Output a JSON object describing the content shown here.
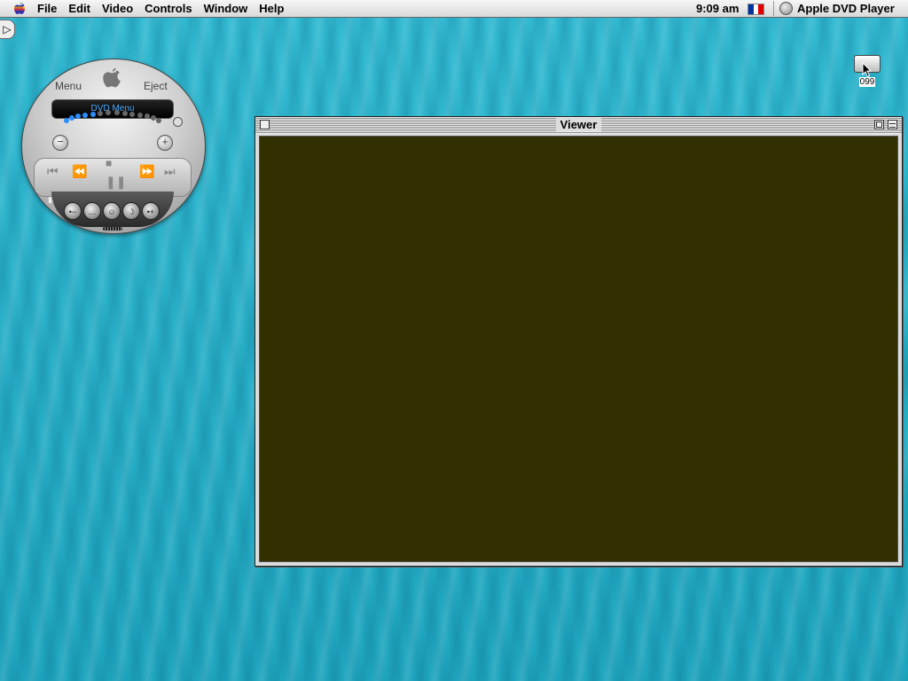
{
  "menubar": {
    "menus": [
      "File",
      "Edit",
      "Video",
      "Controls",
      "Window",
      "Help"
    ],
    "clock": "9:09 am",
    "app_name": "Apple DVD Player",
    "flag_colors": [
      "#0033a0",
      "#ffffff",
      "#e00000"
    ]
  },
  "desktop": {
    "disc_label": "099"
  },
  "controller": {
    "menu_label": "Menu",
    "eject_label": "Eject",
    "display_text": "DVD Menu",
    "volume_dots_lit": 5,
    "volume_dots_total": 14
  },
  "viewer": {
    "title": "Viewer",
    "background_color": "#333000"
  }
}
